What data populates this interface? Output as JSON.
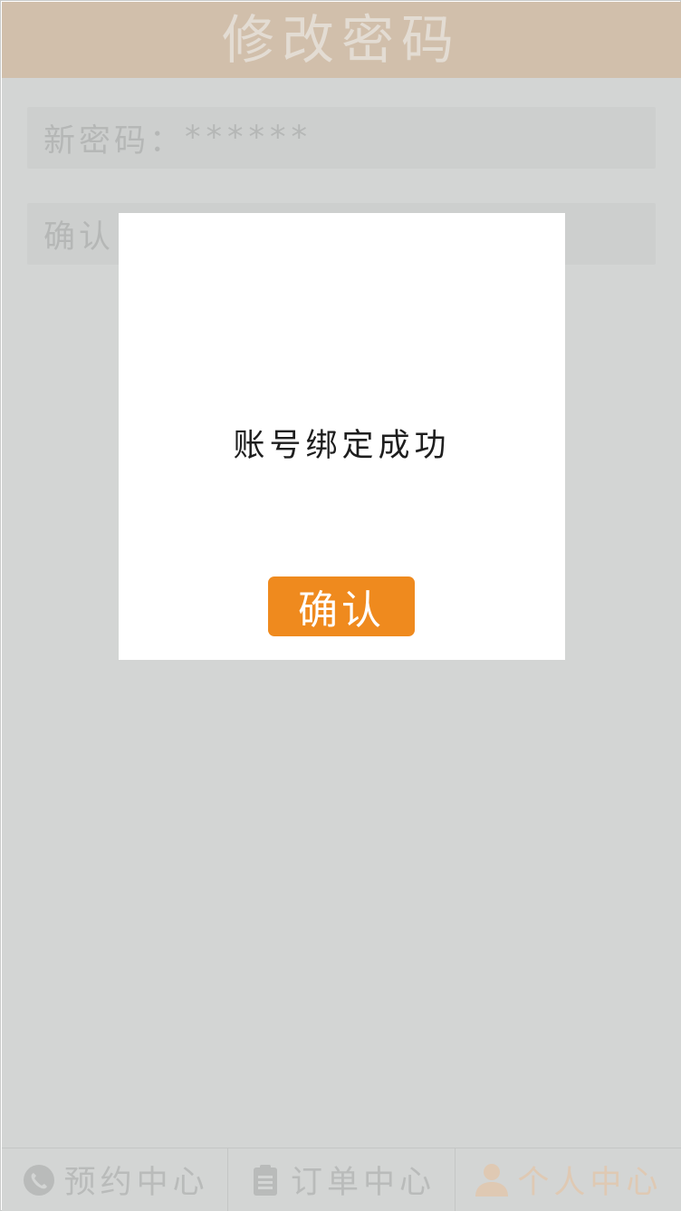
{
  "header": {
    "title": "修改密码"
  },
  "form": {
    "new_password_label": "新密码：",
    "new_password_value": "******",
    "confirm_label": "确认"
  },
  "dialog": {
    "message": "账号绑定成功",
    "confirm_label": "确认"
  },
  "tabbar": {
    "tabs": [
      {
        "label": "预约中心",
        "icon": "phone-icon"
      },
      {
        "label": "订单中心",
        "icon": "clipboard-icon"
      },
      {
        "label": "个人中心",
        "icon": "user-icon"
      }
    ]
  },
  "colors": {
    "header_bg": "#d1bfab",
    "content_bg": "#d3d5d4",
    "accent": "#ef8a1e",
    "active_tab": "#dfc9b3"
  }
}
